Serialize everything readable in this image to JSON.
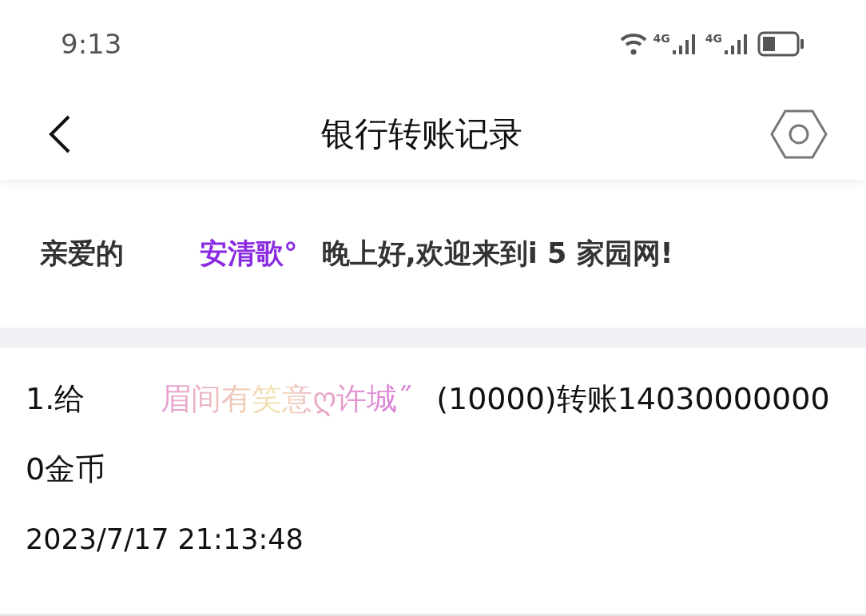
{
  "status_bar": {
    "time": "9:13",
    "network_labels": [
      "4G",
      "4G"
    ]
  },
  "header": {
    "title": "银行转账记录"
  },
  "greeting": {
    "prefix": "亲爱的",
    "user": "安清歌°",
    "message": "晚上好,欢迎来到i 5 家园网!"
  },
  "records": [
    {
      "index": "1.给",
      "recipient": "眉间有笑意ღ许城˝",
      "detail": "(10000)转账140300000000金币",
      "time": "2023/7/17 21:13:48"
    }
  ]
}
